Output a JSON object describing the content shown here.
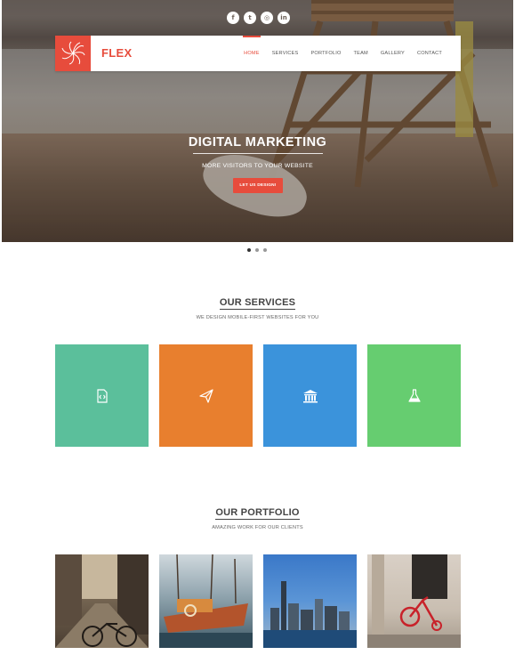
{
  "social": {
    "icons": [
      "facebook-icon",
      "twitter-icon",
      "instagram-icon",
      "linkedin-icon"
    ],
    "glyphs": [
      "f",
      "t",
      "◎",
      "in"
    ]
  },
  "nav": {
    "brand": "FLEX",
    "items": [
      "HOME",
      "SERVICES",
      "PORTFOLIO",
      "TEAM",
      "GALLERY",
      "CONTACT"
    ],
    "active": "HOME"
  },
  "hero": {
    "title": "DIGITAL MARKETING",
    "subtitle": "MORE VISITORS TO YOUR WEBSITE",
    "button": "LET US DESIGN!",
    "slides": 3,
    "active_slide": 1
  },
  "services": {
    "title": "OUR SERVICES",
    "subtitle": "WE DESIGN MOBILE-FIRST WEBSITES FOR YOU",
    "tiles": [
      {
        "icon": "code-file-icon",
        "color": "#5bbf9b"
      },
      {
        "icon": "paper-plane-icon",
        "color": "#e87f2e"
      },
      {
        "icon": "bank-icon",
        "color": "#3b93db"
      },
      {
        "icon": "flask-icon",
        "color": "#66cd70"
      }
    ]
  },
  "portfolio": {
    "title": "OUR PORTFOLIO",
    "subtitle": "AMAZING WORK FOR OUR CLIENTS",
    "items": [
      "street-bicycle-photo",
      "harbor-boats-photo",
      "city-skyline-photo",
      "red-tricycle-photo"
    ]
  },
  "colors": {
    "accent": "#e74c3c"
  }
}
